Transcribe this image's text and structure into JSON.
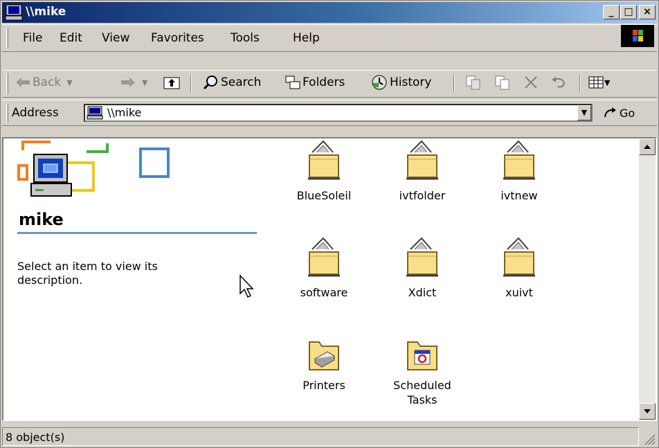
{
  "window": {
    "title": "\\\\mike",
    "minimize": "_",
    "maximize": "□",
    "close": "×"
  },
  "menu": {
    "items": [
      "File",
      "Edit",
      "View",
      "Favorites",
      "Tools",
      "Help"
    ]
  },
  "toolbar": {
    "back": "Back",
    "search": "Search",
    "folders": "Folders",
    "history": "History"
  },
  "address": {
    "label": "Address",
    "value": "\\\\mike",
    "go": "Go"
  },
  "leftpane": {
    "title": "mike",
    "description": "Select an item to view its description."
  },
  "items": [
    {
      "label": "BlueSoleil",
      "icon": "shared-folder-icon"
    },
    {
      "label": "ivtfolder",
      "icon": "shared-folder-icon"
    },
    {
      "label": "ivtnew",
      "icon": "shared-folder-icon"
    },
    {
      "label": "software",
      "icon": "shared-folder-icon"
    },
    {
      "label": "Xdict",
      "icon": "shared-folder-icon"
    },
    {
      "label": "xuivt",
      "icon": "shared-folder-icon"
    },
    {
      "label": "Printers",
      "icon": "printers-folder-icon"
    },
    {
      "label": "Scheduled Tasks",
      "icon": "scheduled-tasks-folder-icon"
    }
  ],
  "status": {
    "text": "8 object(s)"
  },
  "colors": {
    "title_start": "#0a246a",
    "title_end": "#a6caf0",
    "face": "#d4d0c8",
    "rule": "#6d95bf"
  }
}
